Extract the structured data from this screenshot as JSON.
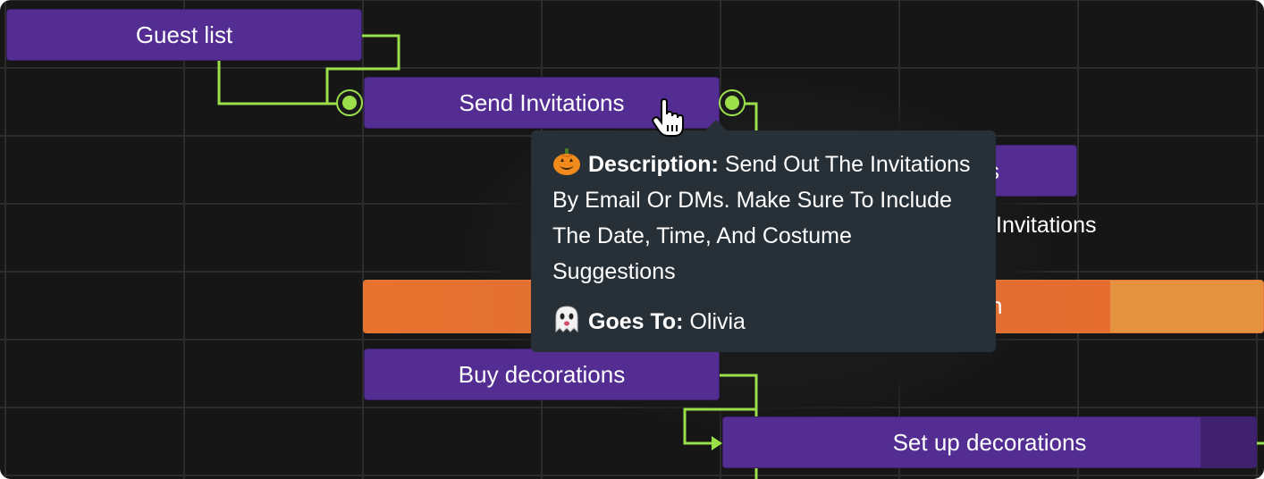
{
  "tasks": {
    "guest_list": "Guest list",
    "send_invitations": "Send Invitations",
    "hidden_task_tail": "s",
    "hidden_task_subtitle_tail": "Invitations",
    "orange_task_tail": "n",
    "buy_decorations": "Buy decorations",
    "set_up_decorations": "Set up decorations"
  },
  "tooltip": {
    "description_icon": "jack-o-lantern-icon",
    "description_label": "Description:",
    "description_text": "Send Out The Invitations By Email Or DMs. Make Sure To Include The Date, Time, And Costume Suggestions",
    "goes_to_icon": "ghost-icon",
    "goes_to_label": "Goes To:",
    "goes_to_value": "Olivia"
  },
  "colors": {
    "canvas": "#161616",
    "task_bar": "#532d91",
    "dependency_line": "#9be04b",
    "tooltip_bg": "#283037",
    "orange_progress": "#e8732e",
    "orange_remaining": "#e59240"
  },
  "progress": {
    "set_up_decorations": 0.9,
    "orange_task": 0.6
  }
}
